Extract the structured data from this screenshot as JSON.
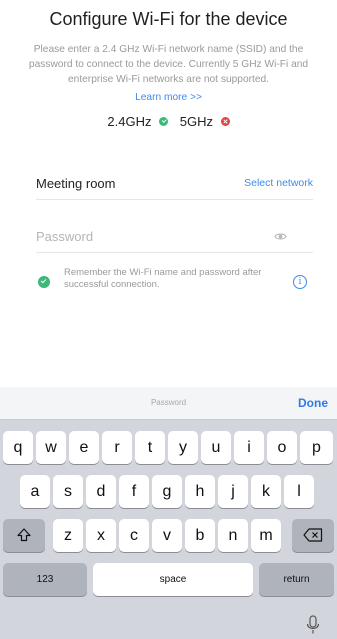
{
  "header": {
    "title": "Configure Wi-Fi for the device",
    "description": "Please enter a 2.4 GHz Wi-Fi network name (SSID) and the password to connect to the device. Currently 5 GHz Wi-Fi and enterprise Wi-Fi networks are not supported.",
    "learn_more": "Learn more >>"
  },
  "bands": {
    "band_24": "2.4GHz",
    "band_24_status": "supported",
    "band_5": "5GHz",
    "band_5_status": "unsupported"
  },
  "form": {
    "ssid_value": "Meeting room",
    "select_network": "Select network",
    "password_placeholder": "Password",
    "remember_text": "Remember the Wi-Fi name and password after successful connection."
  },
  "keyboard": {
    "field_label": "Password",
    "done": "Done",
    "row1": [
      "q",
      "w",
      "e",
      "r",
      "t",
      "y",
      "u",
      "i",
      "o",
      "p"
    ],
    "row2": [
      "a",
      "s",
      "d",
      "f",
      "g",
      "h",
      "j",
      "k",
      "l"
    ],
    "row3": [
      "z",
      "x",
      "c",
      "v",
      "b",
      "n",
      "m"
    ],
    "numbers": "123",
    "space": "space",
    "return": "return"
  },
  "colors": {
    "accent": "#3d8be8",
    "ok": "#3cb878",
    "error": "#e0463f"
  }
}
